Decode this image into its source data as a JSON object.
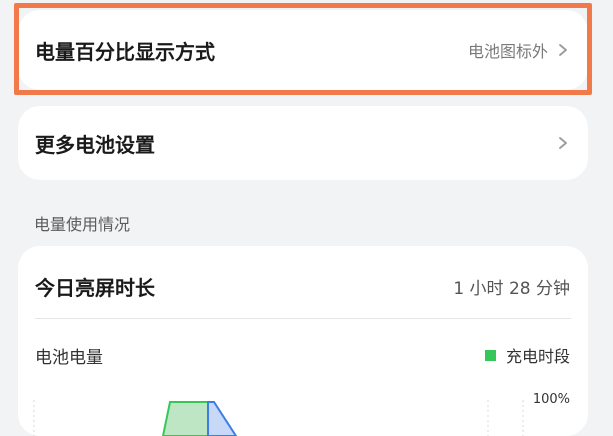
{
  "percent_display": {
    "title": "电量百分比显示方式",
    "value": "电池图标外"
  },
  "more_battery_settings": {
    "title": "更多电池设置"
  },
  "usage_section": {
    "label": "电量使用情况"
  },
  "usage_card": {
    "screen_time_label": "今日亮屏时长",
    "screen_time_value": "1 小时 28 分钟",
    "battery_level_label": "电池电量",
    "legend_charging": "充电时段",
    "y_max_label": "100%"
  },
  "colors": {
    "highlight": "#f27a4a",
    "charging": "#35c759",
    "discharge": "#3d7de8"
  }
}
